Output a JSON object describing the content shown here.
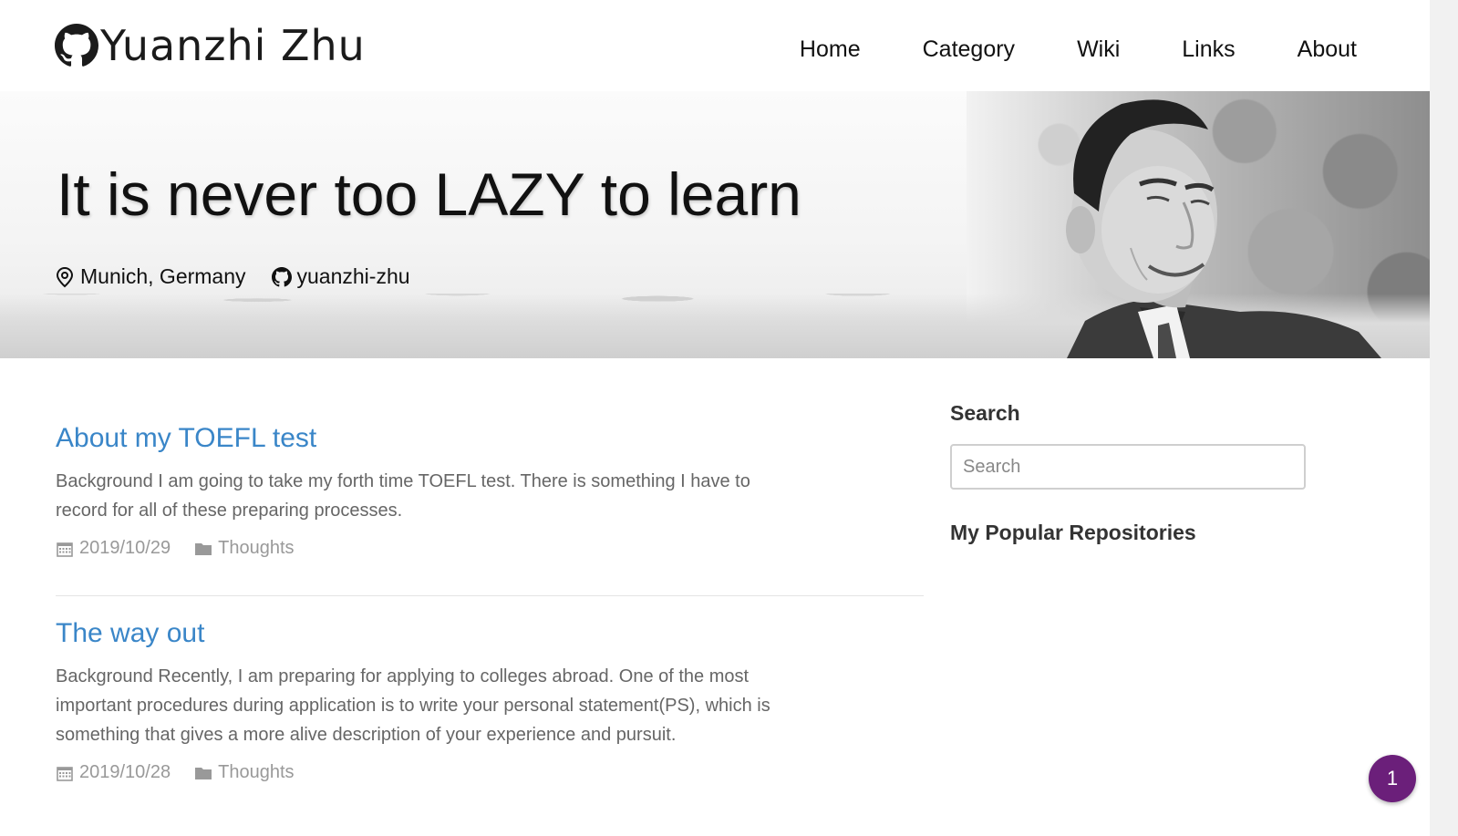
{
  "brand": {
    "name": "Yuanzhi Zhu",
    "icon": "github-icon"
  },
  "nav": [
    {
      "label": "Home"
    },
    {
      "label": "Category"
    },
    {
      "label": "Wiki"
    },
    {
      "label": "Links"
    },
    {
      "label": "About"
    }
  ],
  "hero": {
    "title": "It is never too LAZY to learn",
    "location": "Munich, Germany",
    "github": "yuanzhi-zhu"
  },
  "posts": [
    {
      "title": "About my TOEFL test",
      "excerpt": "Background I am going to take my forth time TOEFL test. There is something I have to record for all of these preparing processes.",
      "date": "2019/10/29",
      "category": "Thoughts"
    },
    {
      "title": "The way out",
      "excerpt": "Background Recently, I am preparing for applying to colleges abroad. One of the most important procedures during application is to write your personal statement(PS), which is something that gives a more alive description of your experience and pursuit.",
      "date": "2019/10/28",
      "category": "Thoughts"
    }
  ],
  "sidebar": {
    "search_heading": "Search",
    "search_placeholder": "Search",
    "repos_heading": "My Popular Repositories"
  },
  "fab": {
    "label": "1"
  },
  "colors": {
    "link": "#3a86c8",
    "fab": "#6b1f7a"
  }
}
